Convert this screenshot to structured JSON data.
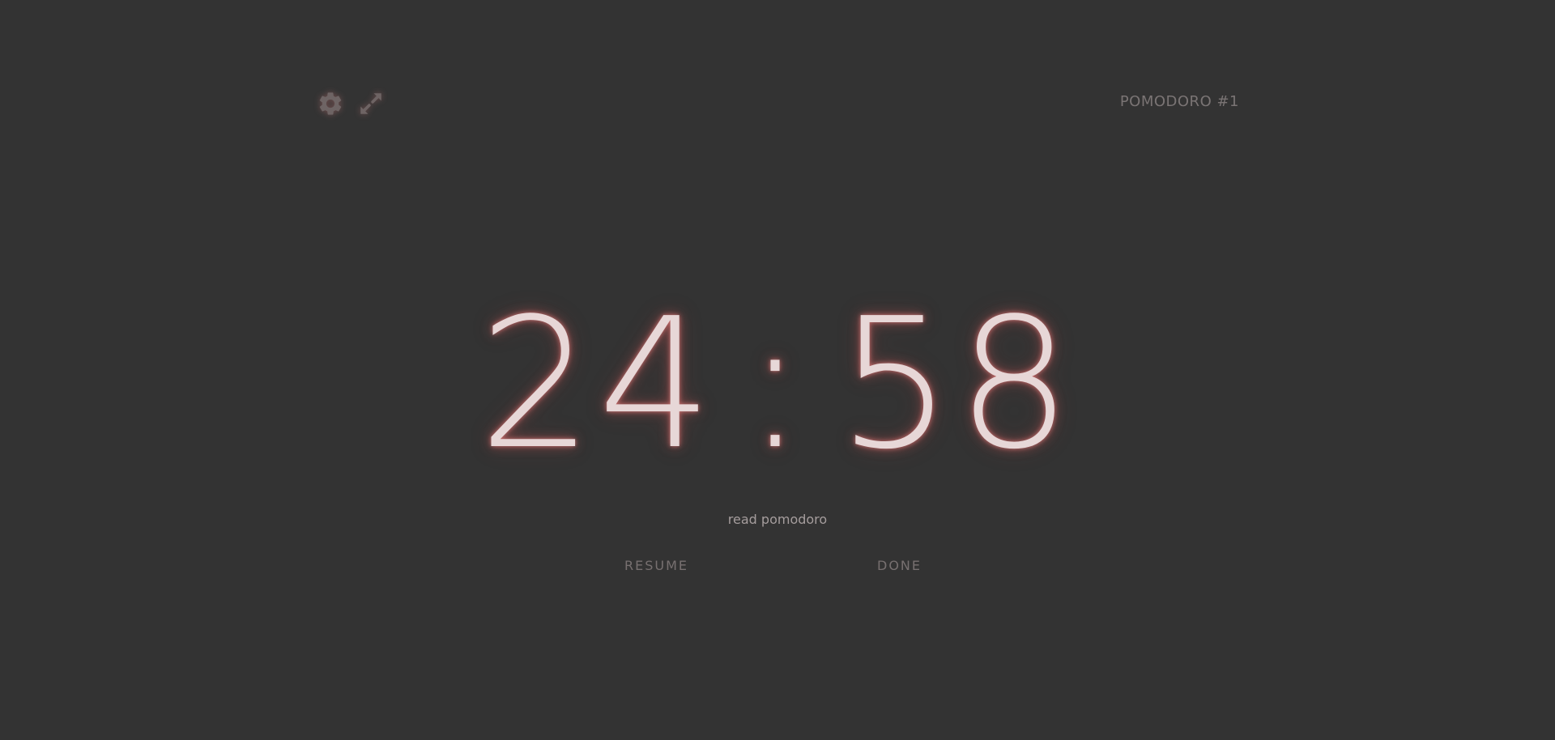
{
  "header": {
    "settings_icon": "gear-icon",
    "fullscreen_icon": "expand-arrows-icon",
    "session_label": "POMODORO #1"
  },
  "timer": {
    "minutes": "24",
    "separator": ":",
    "seconds": "58"
  },
  "task": {
    "name": "read pomodoro"
  },
  "controls": {
    "resume_label": "RESUME",
    "done_label": "DONE"
  },
  "colors": {
    "background": "#333333",
    "timer_text": "#e7d7d7",
    "glow": "#c86464",
    "muted_text": "#777070"
  }
}
